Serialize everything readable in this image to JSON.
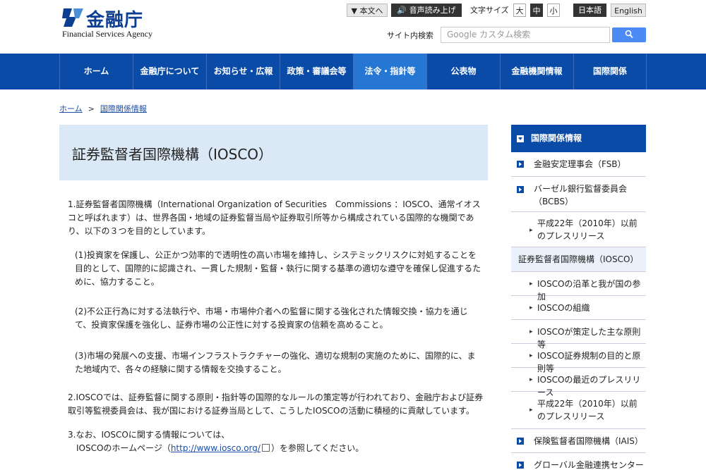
{
  "header": {
    "logo_jp": "金融庁",
    "logo_en": "Financial Services Agency",
    "skip_label": "▼ 本文へ",
    "speech_label": "音声読み上げ",
    "font_size_label": "文字サイズ",
    "font_sizes": [
      "大",
      "中",
      "小"
    ],
    "lang_jp": "日本語",
    "lang_en": "English",
    "search_label": "サイト内検索",
    "search_placeholder": "Google カスタム検索"
  },
  "nav": [
    "ホーム",
    "金融庁について",
    "お知らせ・広報",
    "政策・審議会等",
    "法令・指針等",
    "公表物",
    "金融機関情報",
    "国際関係"
  ],
  "breadcrumb": {
    "home": "ホーム",
    "sep": ">",
    "current": "国際関係情報"
  },
  "main": {
    "title": "証券監督者国際機構（IOSCO）",
    "p1": "1.証券監督者国際機構（International Organization of Securities　Commissions ：IOSCO、通常イオスコと呼ばれます）は、世界各国・地域の証券監督当局や証券取引所等から構成されている国際的な機関であり、以下の３つを目的としています。",
    "s1": "(1)投資家を保護し、公正かつ効率的で透明性の高い市場を維持し、システミックリスクに対処することを目的として、国際的に認識され、一貫した規制・監督・執行に関する基準の適切な遵守を確保し促進するために、協力すること。",
    "s2": "(2)不公正行為に対する法執行や、市場・市場仲介者への監督に関する強化された情報交換・協力を通じて、投資家保護を強化し、証券市場の公正性に対する投資家の信頼を高めること。",
    "s3": "(3)市場の発展への支援、市場インフラストラクチャーの強化、適切な規制の実施のために、国際的に、また地域内で、各々の経験に関する情報を交換すること。",
    "p2": "2.IOSCOでは、証券監督に関する原則・指針等の国際的なルールの策定等が行われており、金融庁および証券取引等監視委員会は、我が国における証券当局として、こうしたIOSCOの活動に積極的に貢献しています。",
    "p3_a": "3.なお、IOSCOに関する情報については、",
    "p3_b": "IOSCOのホームページ（",
    "p3_link": "http://www.iosco.org/",
    "p3_c": "）を参照してください。"
  },
  "sidebar": {
    "head": "国際関係情報",
    "fsb": "金融安定理事会（FSB）",
    "bcbs": "バーゼル銀行監督委員会（BCBS）",
    "bcbs_sub": "平成22年（2010年）以前のプレスリリース",
    "iosco": "証券監督者国際機構（IOSCO）",
    "iosco_subs": [
      "IOSCOの沿革と我が国の参加",
      "IOSCOの組織",
      "IOSCOが策定した主な原則等",
      "IOSCO証券規制の目的と原則等",
      "IOSCOの最近のプレスリリース",
      "平成22年（2010年）以前のプレスリリース"
    ],
    "iais": "保険監督者国際機構（IAIS）",
    "next": "グローバル金融連携センター"
  }
}
